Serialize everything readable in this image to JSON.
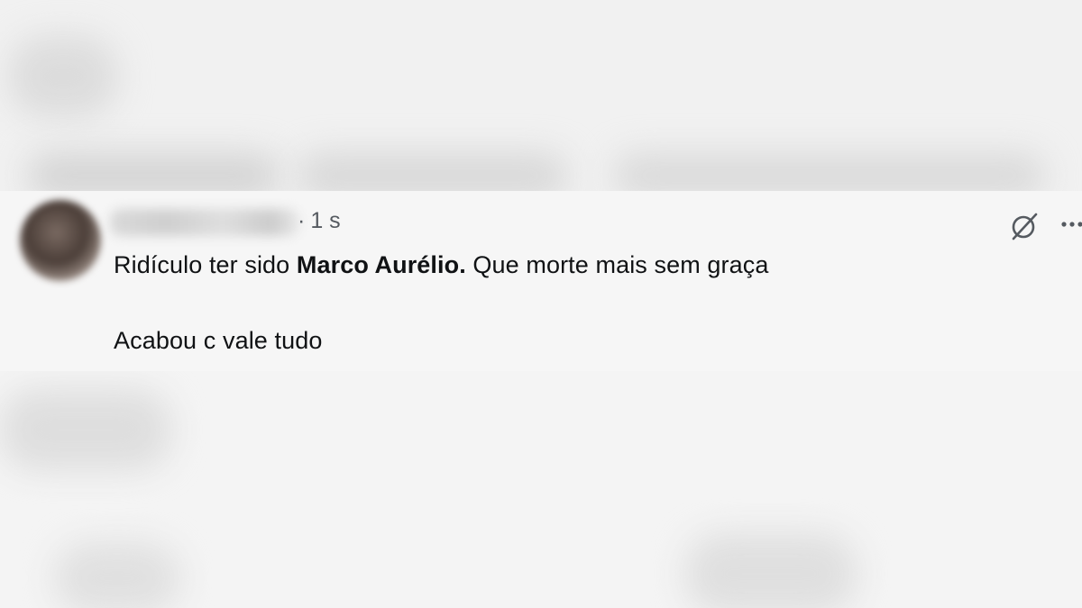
{
  "tweet": {
    "timestamp_separator": "·",
    "timestamp": "1 s",
    "text_before": "Ridículo ter sido ",
    "text_bold": "Marco Aurélio.",
    "text_after": " Que morte mais sem graça",
    "second_line": "Acabou c vale tudo"
  },
  "icons": {
    "grok": "grok-icon",
    "more": "more-options-icon"
  },
  "colors": {
    "background": "#f3f3f3",
    "text": "#101214",
    "muted": "#555a60"
  }
}
